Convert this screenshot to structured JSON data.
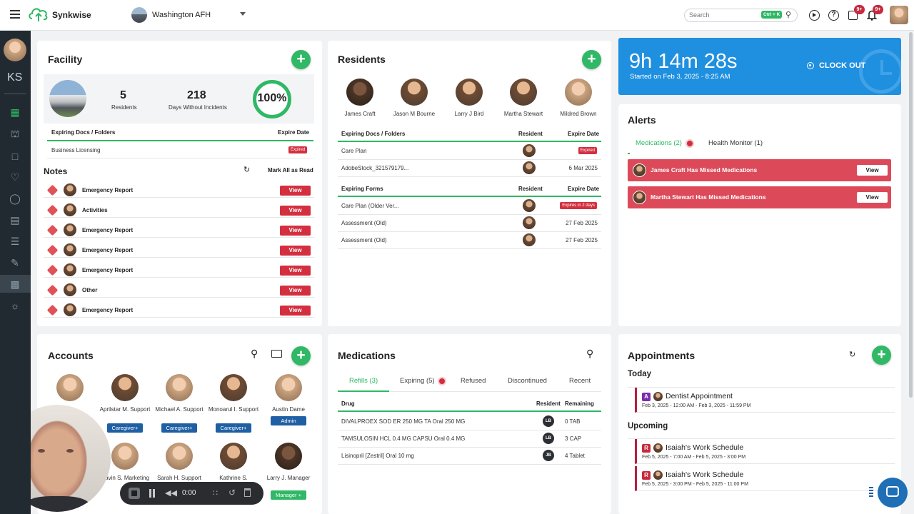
{
  "header": {
    "app_name": "Synkwise",
    "facility_select": "Washington AFH",
    "search_placeholder": "Search",
    "search_shortcut": "Ctrl + K",
    "tasks_badge": "9+",
    "notifications_badge": "9+"
  },
  "sidebar": {
    "initials": "KS"
  },
  "facility": {
    "title": "Facility",
    "residents_count": "5",
    "residents_label": "Residents",
    "days_count": "218",
    "days_label": "Days Without Incidents",
    "progress_label": "100%",
    "progress_value": 1.0,
    "docs_header": "Expiring Docs / Folders",
    "expire_header": "Expire Date",
    "docs": [
      {
        "name": "Business Licensing",
        "status": "Expired"
      }
    ]
  },
  "notes": {
    "title": "Notes",
    "mark_all": "Mark All as Read",
    "view_label": "View",
    "items": [
      "Emergency Report",
      "Activities",
      "Emergency Report",
      "Emergency Report",
      "Emergency Report",
      "Other",
      "Emergency Report"
    ]
  },
  "residents": {
    "title": "Residents",
    "people": [
      "James Craft",
      "Jason M Bourne",
      "Larry J Bird",
      "Martha Stewart",
      "Mildred Brown"
    ],
    "docs_header": "Expiring Docs / Folders",
    "resident_header": "Resident",
    "expire_header": "Expire Date",
    "docs": [
      {
        "name": "Care Plan",
        "date": "Expired"
      },
      {
        "name": "AdobeStock_321579179...",
        "date": "6 Mar 2025"
      }
    ],
    "forms_header": "Expiring Forms",
    "forms": [
      {
        "name": "Care Plan (Older Ver...",
        "date": "Expires in 2 days"
      },
      {
        "name": "Assessment (Old)",
        "date": "27 Feb 2025"
      },
      {
        "name": "Assessment (Old)",
        "date": "27 Feb 2025"
      }
    ]
  },
  "clock": {
    "time": "9h 14m 28s",
    "started": "Started on Feb 3, 2025 - 8:25 AM",
    "clock_out": "CLOCK OUT"
  },
  "alerts": {
    "title": "Alerts",
    "tab_medications": "Medications (2)",
    "tab_health": "Health Monitor (1)",
    "view_label": "View",
    "items": [
      "James Craft Has Missed Medications",
      "Martha Stewart Has Missed Medications"
    ]
  },
  "accounts": {
    "title": "Accounts",
    "people": [
      {
        "name": "",
        "role": ""
      },
      {
        "name": "Aprilstar M. Support",
        "role": "Caregiver+"
      },
      {
        "name": "Michael A. Support",
        "role": "Caregiver+"
      },
      {
        "name": "Monoarul I. Support",
        "role": "Caregiver+"
      },
      {
        "name": "Austin Dame",
        "role": "Admin"
      },
      {
        "name": "",
        "role": ""
      },
      {
        "name": "Gavin S. Marketing",
        "role": ""
      },
      {
        "name": "Sarah H. Support",
        "role": ""
      },
      {
        "name": "Kathrine S.",
        "role": ""
      },
      {
        "name": "Larry J. Manager",
        "role": "Manager +"
      }
    ]
  },
  "recorder": {
    "time": "0:00"
  },
  "medications": {
    "title": "Medications",
    "tabs": [
      "Refills (3)",
      "Expiring (5)",
      "Refused",
      "Discontinued",
      "Recent"
    ],
    "headers": {
      "drug": "Drug",
      "resident": "Resident",
      "remaining": "Remaining"
    },
    "rows": [
      {
        "drug": "DIVALPROEX SOD ER 250 MG TA Oral 250 MG",
        "resident": "LB",
        "remaining": "0 TAB"
      },
      {
        "drug": "TAMSULOSIN HCL 0.4 MG CAPSU Oral 0.4 MG",
        "resident": "LB",
        "remaining": "3 CAP"
      },
      {
        "drug": "Lisinopril [Zestril] Oral 10 mg",
        "resident": "JB",
        "remaining": "4 Tablet"
      }
    ]
  },
  "appointments": {
    "title": "Appointments",
    "today_label": "Today",
    "upcoming_label": "Upcoming",
    "today": [
      {
        "badge": "A",
        "title": "Dentist Appointment",
        "time": "Feb 3, 2025 - 12:00 AM - Feb 3, 2025 - 11:59 PM"
      }
    ],
    "upcoming": [
      {
        "badge": "R",
        "title": "Isaiah's Work Schedule",
        "time": "Feb 5, 2025 - 7:00 AM - Feb 5, 2025 - 3:00 PM"
      },
      {
        "badge": "R",
        "title": "Isaiah's Work Schedule",
        "time": "Feb 5, 2025 - 3:00 PM - Feb 5, 2025 - 11:00 PM"
      }
    ]
  }
}
